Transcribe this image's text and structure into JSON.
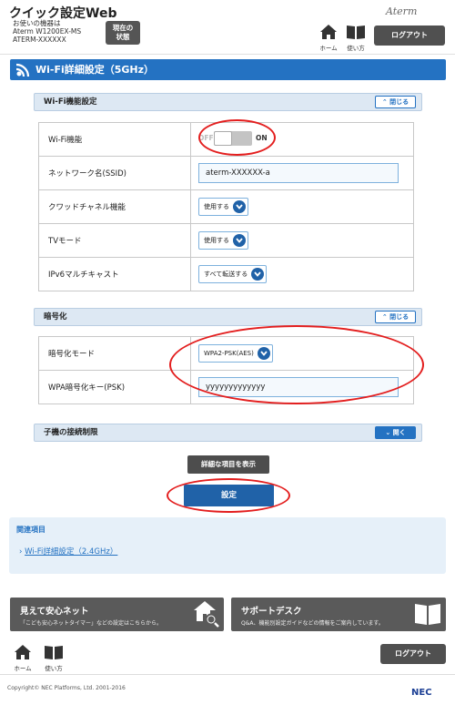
{
  "header": {
    "app_title": "クイック設定Web",
    "device_label": "お使いの機器は",
    "model": "Aterm W1200EX-MS",
    "ssid_name": "ATERM-XXXXXX",
    "status_button": "現在の\n状態",
    "brand": "Aterm",
    "home_label": "ホーム",
    "help_label": "使い方",
    "logout": "ログアウト"
  },
  "page_title": "Wi-Fi詳細設定（5GHz）",
  "sections": {
    "wifi_function": {
      "title": "Wi-Fi機能設定",
      "collapse": "閉じる",
      "rows": {
        "wifi": {
          "label": "Wi-Fi機能",
          "off": "OFF",
          "on": "ON"
        },
        "ssid": {
          "label": "ネットワーク名(SSID)",
          "value": "aterm-XXXXXX-a"
        },
        "quad_channel": {
          "label": "クワッドチャネル機能",
          "value": "使用する"
        },
        "tv_mode": {
          "label": "TVモード",
          "value": "使用する"
        },
        "ipv6_multicast": {
          "label": "IPv6マルチキャスト",
          "value": "すべて転送する"
        }
      }
    },
    "encryption": {
      "title": "暗号化",
      "collapse": "閉じる",
      "rows": {
        "mode": {
          "label": "暗号化モード",
          "value": "WPA2-PSK(AES)"
        },
        "psk": {
          "label": "WPA暗号化キー(PSK)",
          "value": "yyyyyyyyyyyyy"
        }
      }
    },
    "access_limit": {
      "title": "子機の接続制限",
      "expand": "開く"
    }
  },
  "buttons": {
    "show_details": "詳細な項目を表示",
    "submit": "設定"
  },
  "related": {
    "title": "関連項目",
    "link": "Wi-Fi詳細設定（2.4GHz）"
  },
  "promos": {
    "safe_net": {
      "title": "見えて安心ネット",
      "desc": "「こども安心ネットタイマー」などの設定はこちらから。"
    },
    "support": {
      "title": "サポートデスク",
      "desc": "Q&A、機能別設定ガイドなどの情報をご案内しています。"
    }
  },
  "footer": {
    "home_label": "ホーム",
    "help_label": "使い方",
    "logout": "ログアウト",
    "copyright": "Copyright© NEC Platforms, Ltd. 2001-2016",
    "brand": "NEC"
  },
  "colors": {
    "accent": "#2472c2",
    "dark_button": "#505050",
    "highlight_ellipse": "#e31e1e"
  }
}
